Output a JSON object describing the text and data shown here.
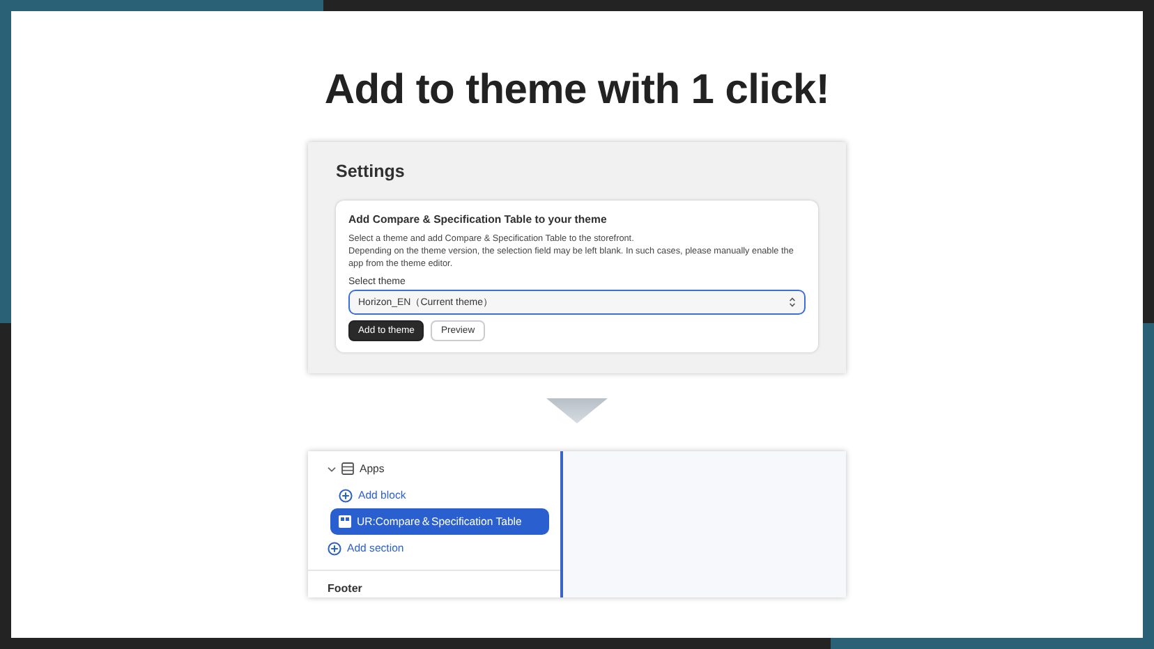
{
  "title": "Add to theme with 1 click!",
  "settings": {
    "heading": "Settings",
    "card_title": "Add Compare & Specification Table to your theme",
    "description": [
      "Select a theme and add Compare & Specification Table to the storefront.",
      "Depending on the theme version, the selection field may be left blank. In such cases, please manually enable the app from the theme editor."
    ],
    "select_label": "Select theme",
    "select_value": "Horizon_EN（Current theme）",
    "buttons": [
      {
        "label": "Add to theme",
        "kind": "primary"
      },
      {
        "label": "Preview",
        "kind": "secondary"
      }
    ]
  },
  "editor": {
    "tree": [
      {
        "kind": "group",
        "label": "Apps",
        "expanded": true,
        "selected": false,
        "children": [
          {
            "kind": "add",
            "label": "Add block",
            "selected": false
          },
          {
            "kind": "block",
            "label": "UR:Compare＆Specification Table",
            "selected": true
          }
        ]
      },
      {
        "kind": "add",
        "label": "Add section",
        "selected": false
      }
    ],
    "footer": "Footer"
  }
}
